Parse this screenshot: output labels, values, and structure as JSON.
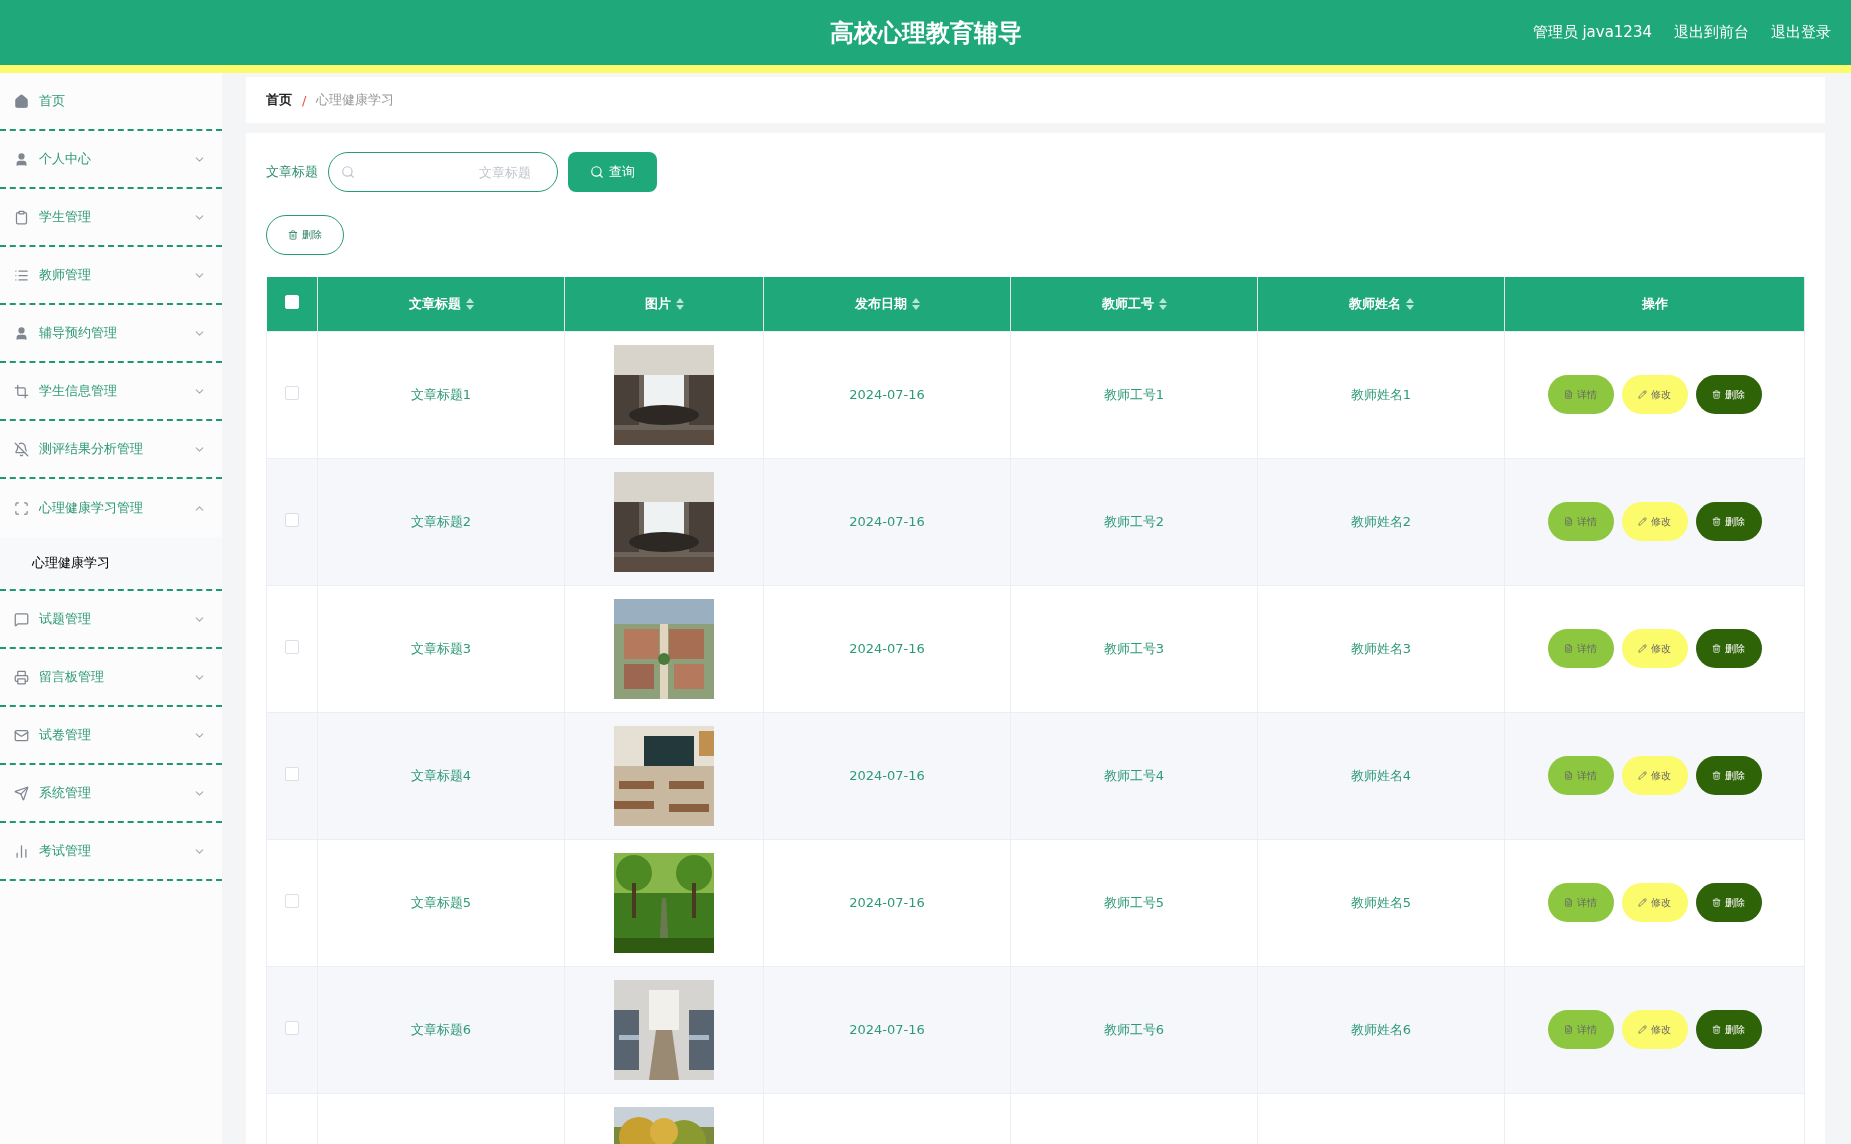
{
  "header": {
    "title": "高校心理教育辅导",
    "links": [
      "管理员 java1234",
      "退出到前台",
      "退出登录"
    ]
  },
  "sidebar": {
    "items": [
      {
        "label": "首页",
        "kind": "link",
        "selected": false
      },
      {
        "label": "个人中心",
        "kind": "menu",
        "expanded": false,
        "selected": false
      },
      {
        "label": "学生管理",
        "kind": "menu",
        "expanded": false,
        "selected": false
      },
      {
        "label": "教师管理",
        "kind": "menu",
        "expanded": false,
        "selected": false
      },
      {
        "label": "辅导预约管理",
        "kind": "menu",
        "expanded": false,
        "selected": false
      },
      {
        "label": "学生信息管理",
        "kind": "menu",
        "expanded": false,
        "selected": false
      },
      {
        "label": "测评结果分析管理",
        "kind": "menu",
        "expanded": false,
        "selected": false
      },
      {
        "label": "心理健康学习管理",
        "kind": "menu",
        "expanded": true,
        "selected": false,
        "children": [
          {
            "label": "心理健康学习",
            "selected": true
          }
        ]
      },
      {
        "label": "试题管理",
        "kind": "menu",
        "expanded": false,
        "selected": false
      },
      {
        "label": "留言板管理",
        "kind": "menu",
        "expanded": false,
        "selected": false
      },
      {
        "label": "试卷管理",
        "kind": "menu",
        "expanded": false,
        "selected": false
      },
      {
        "label": "系统管理",
        "kind": "menu",
        "expanded": false,
        "selected": false
      },
      {
        "label": "考试管理",
        "kind": "menu",
        "expanded": false,
        "selected": false
      }
    ]
  },
  "breadcrumb": [
    "首页",
    "/",
    "心理健康学习"
  ],
  "search": {
    "label": "文章标题",
    "placeholder": "文章标题",
    "button": "查询"
  },
  "toolbar": {
    "delete": "删除"
  },
  "table": {
    "select_all": {
      "checked": false
    },
    "columns": [
      {
        "label": "文章标题",
        "sortable": true
      },
      {
        "label": "图片",
        "sortable": true
      },
      {
        "label": "发布日期",
        "sortable": true
      },
      {
        "label": "教师工号",
        "sortable": true
      },
      {
        "label": "教师姓名",
        "sortable": true
      },
      {
        "label": "操作",
        "sortable": false
      }
    ],
    "rows": [
      {
        "checked": false,
        "title": "文章标题1",
        "picture": {
          "kind": "picture"
        },
        "date": "2024-07-16",
        "teacher_no": "教师工号1",
        "teacher_name": "教师姓名1",
        "actions": [
          "详情",
          "修改",
          "删除"
        ]
      },
      {
        "checked": false,
        "title": "文章标题2",
        "picture": {
          "kind": "picture"
        },
        "date": "2024-07-16",
        "teacher_no": "教师工号2",
        "teacher_name": "教师姓名2",
        "actions": [
          "详情",
          "修改",
          "删除"
        ]
      },
      {
        "checked": false,
        "title": "文章标题3",
        "picture": {
          "kind": "picture"
        },
        "date": "2024-07-16",
        "teacher_no": "教师工号3",
        "teacher_name": "教师姓名3",
        "actions": [
          "详情",
          "修改",
          "删除"
        ]
      },
      {
        "checked": false,
        "title": "文章标题4",
        "picture": {
          "kind": "picture"
        },
        "date": "2024-07-16",
        "teacher_no": "教师工号4",
        "teacher_name": "教师姓名4",
        "actions": [
          "详情",
          "修改",
          "删除"
        ]
      },
      {
        "checked": false,
        "title": "文章标题5",
        "picture": {
          "kind": "picture"
        },
        "date": "2024-07-16",
        "teacher_no": "教师工号5",
        "teacher_name": "教师姓名5",
        "actions": [
          "详情",
          "修改",
          "删除"
        ]
      },
      {
        "checked": false,
        "title": "文章标题6",
        "picture": {
          "kind": "picture"
        },
        "date": "2024-07-16",
        "teacher_no": "教师工号6",
        "teacher_name": "教师姓名6",
        "actions": [
          "详情",
          "修改",
          "删除"
        ]
      },
      {
        "picture": {
          "kind": "picture"
        }
      }
    ]
  }
}
